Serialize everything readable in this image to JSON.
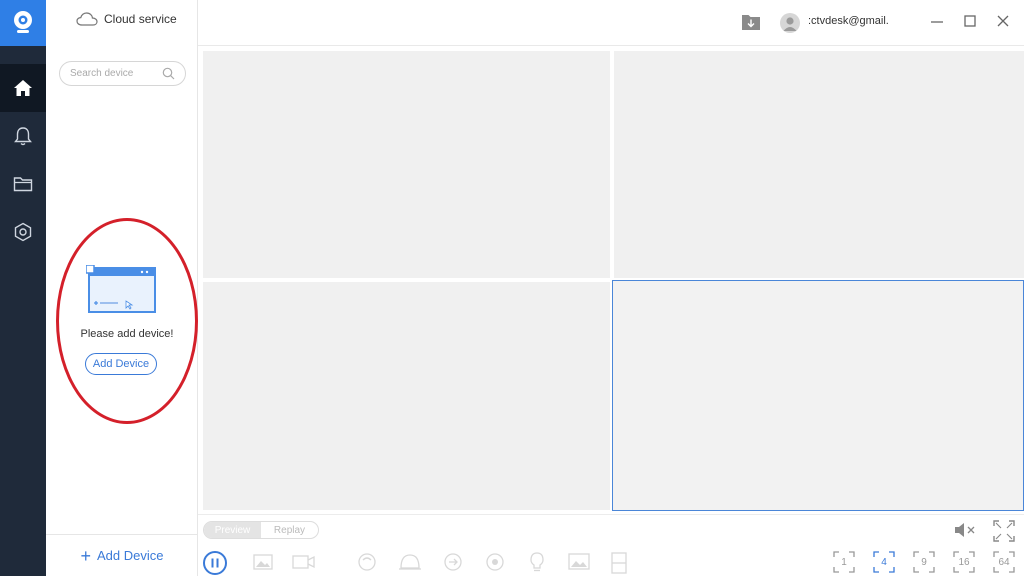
{
  "sidebar": {
    "cloud_label": "Cloud service",
    "search_placeholder": "Search device",
    "empty_message": "Please add device!",
    "add_device_small": "Add Device",
    "add_device_bottom": "Add Device"
  },
  "topbar": {
    "email": ":ctvdesk@gmail."
  },
  "controls": {
    "tabs": [
      "Preview",
      "Replay"
    ],
    "splits": [
      "1",
      "4",
      "9",
      "16",
      "64"
    ],
    "active_split": "4"
  },
  "colors": {
    "accent": "#3a7ad8",
    "rail": "#1f2a3a",
    "highlight": "#d4202a"
  }
}
